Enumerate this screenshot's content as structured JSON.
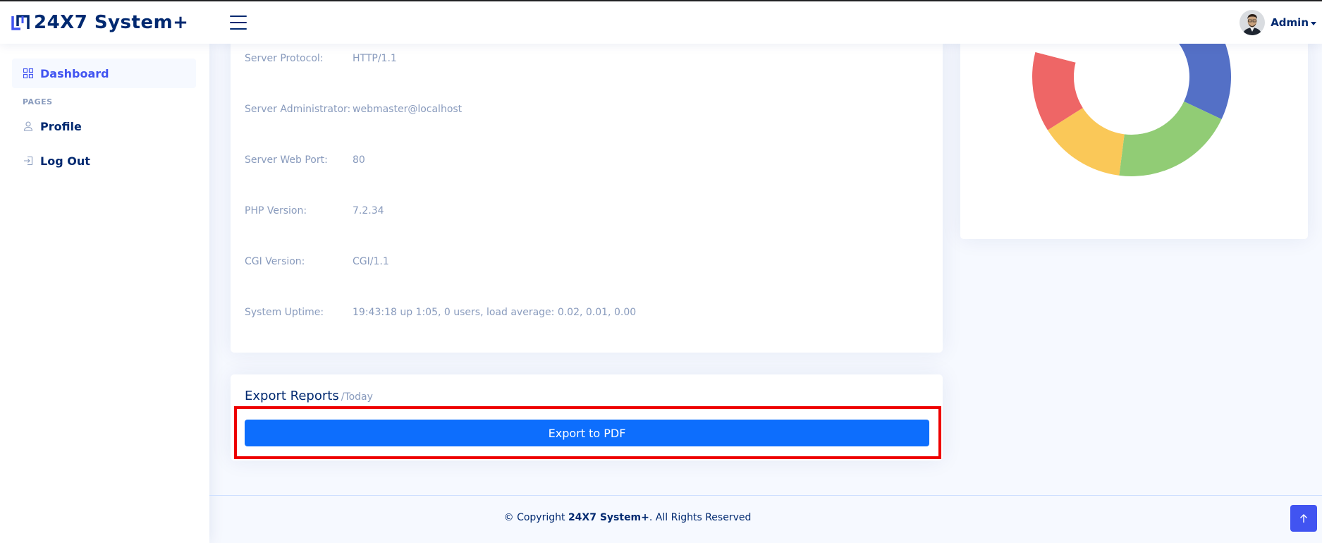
{
  "app": {
    "name": "24X7 System+"
  },
  "header": {
    "user_name": "Admin"
  },
  "sidebar": {
    "items": [
      {
        "label": "Dashboard",
        "icon": "grid-icon",
        "active": true
      },
      {
        "label": "Profile",
        "icon": "person-icon",
        "active": false
      },
      {
        "label": "Log Out",
        "icon": "box-arrow-in-right-icon",
        "active": false
      }
    ],
    "heading": "PAGES"
  },
  "server_info": [
    {
      "key": "Server Protocol:",
      "value": "HTTP/1.1"
    },
    {
      "key": "Server Administrator:",
      "value": "webmaster@localhost"
    },
    {
      "key": "Server Web Port:",
      "value": "80"
    },
    {
      "key": "PHP Version:",
      "value": "7.2.34"
    },
    {
      "key": "CGI Version:",
      "value": "CGI/1.1"
    },
    {
      "key": "System Uptime:",
      "value": "19:43:18 up 1:05, 0 users, load average: 0.02, 0.01, 0.00"
    }
  ],
  "chart_data": {
    "type": "pie",
    "variant": "donut",
    "values": [
      32,
      20,
      14,
      13,
      19,
      2
    ],
    "colors": [
      "#5470c6",
      "#91cc75",
      "#fac858",
      "#ee6666",
      "#ffffff",
      "#73c0de"
    ]
  },
  "export": {
    "title": "Export Reports",
    "subtitle": "/Today",
    "button_label": "Export to PDF"
  },
  "footer": {
    "prefix": "© Copyright ",
    "brand": "24X7 System+",
    "suffix": ". All Rights Reserved"
  },
  "colors": {
    "primary": "#4154f1",
    "button": "#0d6efd",
    "highlight": "#ee0000",
    "text_dark": "#012970",
    "text_muted": "#899bbd"
  }
}
